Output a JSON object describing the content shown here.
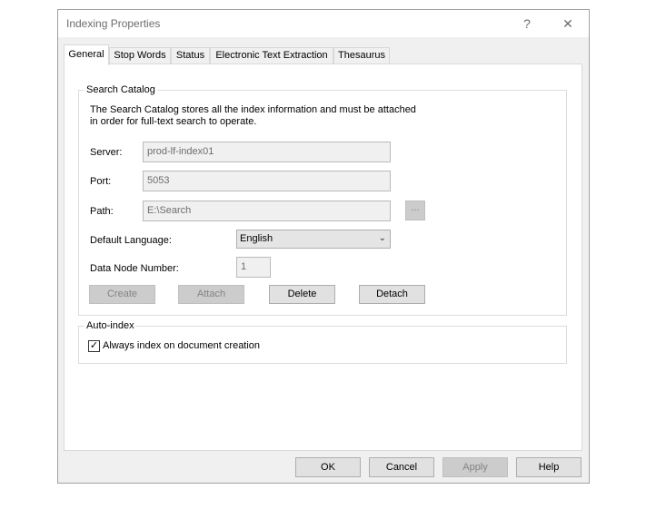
{
  "window": {
    "title": "Indexing Properties",
    "help_glyph": "?",
    "close_glyph": "✕"
  },
  "tabs": [
    {
      "label": "General",
      "active": true
    },
    {
      "label": "Stop Words",
      "active": false
    },
    {
      "label": "Status",
      "active": false
    },
    {
      "label": "Electronic Text Extraction",
      "active": false
    },
    {
      "label": "Thesaurus",
      "active": false
    }
  ],
  "search_catalog": {
    "group_label": "Search Catalog",
    "description_line1": "The Search Catalog stores all the index information and must be attached",
    "description_line2": "in order for full-text search to operate.",
    "server_label": "Server:",
    "server_value": "prod-lf-index01",
    "port_label": "Port:",
    "port_value": "5053",
    "path_label": "Path:",
    "path_value": "E:\\Search",
    "browse_label": "...",
    "language_label": "Default Language:",
    "language_value": "English",
    "node_label": "Data Node Number:",
    "node_value": "1",
    "buttons": {
      "create": "Create",
      "attach": "Attach",
      "delete": "Delete",
      "detach": "Detach"
    }
  },
  "auto_index": {
    "group_label": "Auto-index",
    "checkbox_label": "Always index on document creation",
    "checked": true,
    "check_glyph": "✓"
  },
  "footer": {
    "ok": "OK",
    "cancel": "Cancel",
    "apply": "Apply",
    "help": "Help"
  }
}
